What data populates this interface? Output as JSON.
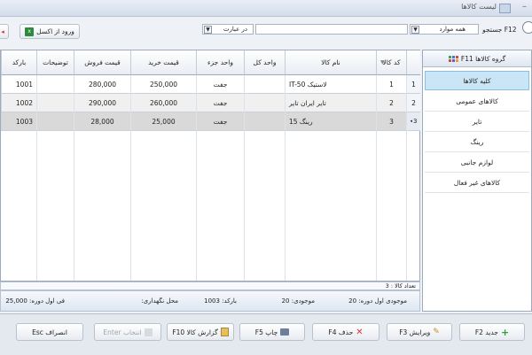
{
  "window": {
    "title": "لیست کالاها"
  },
  "toolbar": {
    "search_label": "جستجو F12",
    "scope_value": "همه موارد",
    "match_value": "در عبارت",
    "excel_button": "ورود از اکسل"
  },
  "grid": {
    "columns": {
      "code": "کد کالا",
      "name": "نام کالا",
      "total_unit": "واحد کل",
      "part_unit": "واحد جزء",
      "buy_price": "قیمت خرید",
      "sell_price": "قیمت فروش",
      "description": "توضیحات",
      "barcode": "بارکد"
    },
    "rows": [
      {
        "num": "1",
        "code": "1",
        "name": "لاستیک IT-50",
        "total_unit": "",
        "part_unit": "جفت",
        "buy_price": "250,000",
        "sell_price": "280,000",
        "description": "",
        "barcode": "1001"
      },
      {
        "num": "2",
        "code": "2",
        "name": "تایر ایران تایر",
        "total_unit": "",
        "part_unit": "جفت",
        "buy_price": "260,000",
        "sell_price": "290,000",
        "description": "",
        "barcode": "1002"
      },
      {
        "num": "3",
        "code": "3",
        "name": "رینگ 15",
        "total_unit": "",
        "part_unit": "جفت",
        "buy_price": "25,000",
        "sell_price": "28,000",
        "description": "",
        "barcode": "1003"
      }
    ],
    "count_text": "تعداد کالا : 3"
  },
  "info": {
    "stock_start": "موجودی اول دوره: 20",
    "stock": "موجودی: 20",
    "barcode": "بارکد: 1003",
    "storage": "محل نگهداری:",
    "price_start": "فی اول دوره: 25,000"
  },
  "groups": {
    "header": "گروه کالاها F11",
    "items": [
      "کلیه کالاها",
      "کالاهای عمومی",
      "تایر",
      "رینگ",
      "لوازم جانبی",
      "کالاهای غیر فعال"
    ]
  },
  "actions": {
    "new": "جدید F2",
    "edit": "ویرایش F3",
    "delete": "حذف F4",
    "print": "چاپ F5",
    "report": "گزارش کالا F10",
    "select": "انتخاب Enter",
    "cancel": "انصراف Esc"
  },
  "colors": {
    "accent": "#c9e5f6",
    "selected_row": "#d9d9d9"
  }
}
